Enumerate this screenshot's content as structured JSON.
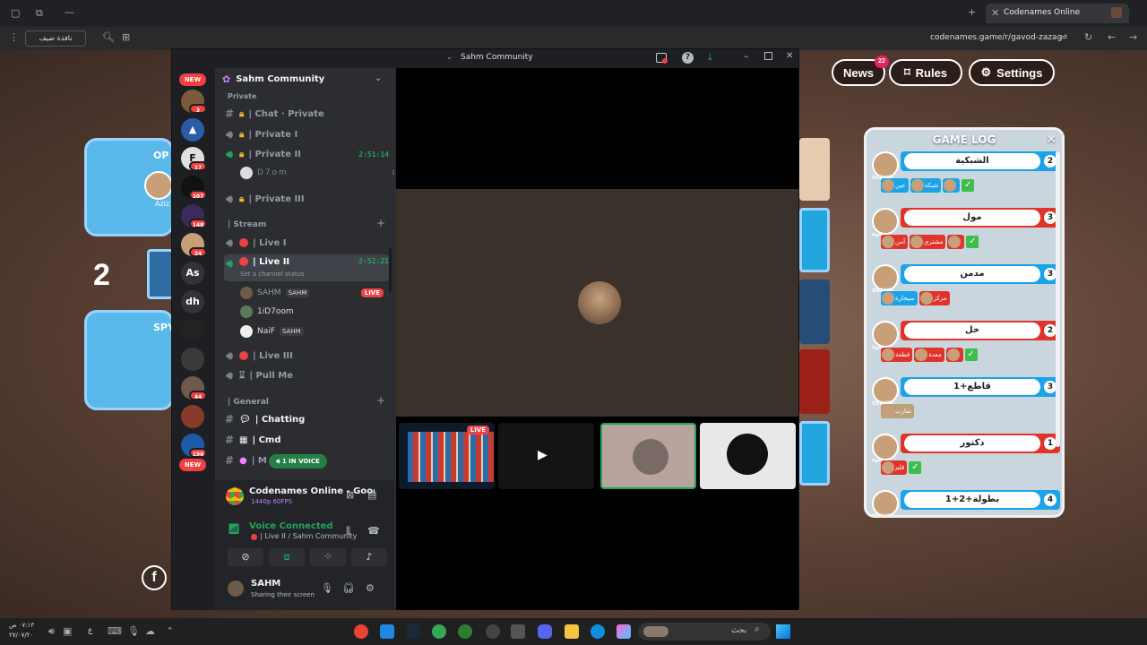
{
  "browser": {
    "tab_title": "Codenames Online",
    "url": "codenames.game/r/gavod-zazag",
    "guest_label": "نافذة ضيف"
  },
  "game": {
    "nav": {
      "news": "News",
      "news_badge": "22",
      "rules": "Rules",
      "settings": "Settings"
    },
    "score_left": "2",
    "card_top_label": "OP",
    "card_top_name": "Aziz",
    "card_bottom_label": "SPY",
    "gamelog": {
      "title": "GAME LOG",
      "entries": [
        {
          "team": "blue",
          "player": "SSAHM",
          "word": "الشبكية",
          "count": "2",
          "guesses": [
            {
              "label": "عين",
              "color": "blue"
            },
            {
              "label": "شبكة",
              "color": "blue"
            },
            {
              "label": "",
              "color": "blue"
            }
          ],
          "ok": true
        },
        {
          "team": "red",
          "player": "صفوة",
          "word": "مول",
          "count": "3",
          "guesses": [
            {
              "label": "أمن",
              "color": "red"
            },
            {
              "label": "مشتري",
              "color": "red"
            },
            {
              "label": "",
              "color": "red"
            }
          ],
          "ok": true
        },
        {
          "team": "blue",
          "player": "SSAHM",
          "word": "مدمن",
          "count": "3",
          "guesses": [
            {
              "label": "سيجارة",
              "color": "blue"
            },
            {
              "label": "مركز",
              "color": "red"
            }
          ],
          "ok": false
        },
        {
          "team": "red",
          "player": "صفوة",
          "word": "خل",
          "count": "2",
          "guesses": [
            {
              "label": "قطعة",
              "color": "red"
            },
            {
              "label": "معدة",
              "color": "red"
            },
            {
              "label": "",
              "color": "red"
            }
          ],
          "ok": true
        },
        {
          "team": "blue",
          "player": "SSAHM",
          "word": "قاطع+1",
          "count": "3",
          "guesses": [
            {
              "label": "شارب",
              "color": "tan"
            }
          ],
          "ok": false
        },
        {
          "team": "red",
          "player": "صفوة",
          "word": "دكتور",
          "count": "1",
          "guesses": [
            {
              "label": "قلم",
              "color": "red"
            }
          ],
          "ok": true
        },
        {
          "team": "blue",
          "player": "SSAHM",
          "word": "بطولة+2+1",
          "count": "4",
          "guesses": [],
          "ok": false
        }
      ]
    },
    "facebook": "f"
  },
  "discord": {
    "window_title": "Sahm Community",
    "server_name": "Sahm Community",
    "rail": {
      "new_top": "NEW",
      "new_bottom": "NEW",
      "badges": [
        "3",
        "17",
        "107",
        "148",
        "24",
        "44",
        "196"
      ],
      "text_servers": [
        "As",
        "dh"
      ]
    },
    "channels": {
      "private_cat": "Private",
      "chat_private": "| Chat · Private",
      "private_1": "| Private I",
      "private_2": "| Private II",
      "private_2_timer": "2:51:14",
      "private_2_user": "D7om",
      "private_3": "| Private III",
      "stream_cat": "| Stream",
      "live_1": "| Live I",
      "live_2": "| Live II",
      "live_2_timer": "2:52:21",
      "live_2_status": "Set a channel status",
      "users": [
        {
          "name": "SAHM",
          "tag": "SAHM",
          "live": "LIVE"
        },
        {
          "name": "1iD7oom",
          "tag": "",
          "live": ""
        },
        {
          "name": "NaiF",
          "tag": "SAHM",
          "live": ""
        }
      ],
      "live_3": "| Live III",
      "pull_me": "| Pull Me",
      "general_cat": "| General",
      "chatting": "| Chatting",
      "cmd": "| Cmd",
      "m_partial": "| M",
      "in_voice": "1 IN VOICE"
    },
    "stream_panel": {
      "app_title": "Codenames Online - Google C...",
      "quality": "1440p 60FPS",
      "voice_status": "Voice Connected",
      "voice_channel": "| Live II / Sahm Community"
    },
    "user": {
      "name": "SAHM",
      "status": "Sharing their screen"
    },
    "tiles": {
      "live": "LIVE"
    }
  },
  "taskbar": {
    "time": "٠٧:١٣ ص",
    "date": "٢٧/٠٧/٢٠",
    "lang": "ع",
    "search": "بحث"
  }
}
